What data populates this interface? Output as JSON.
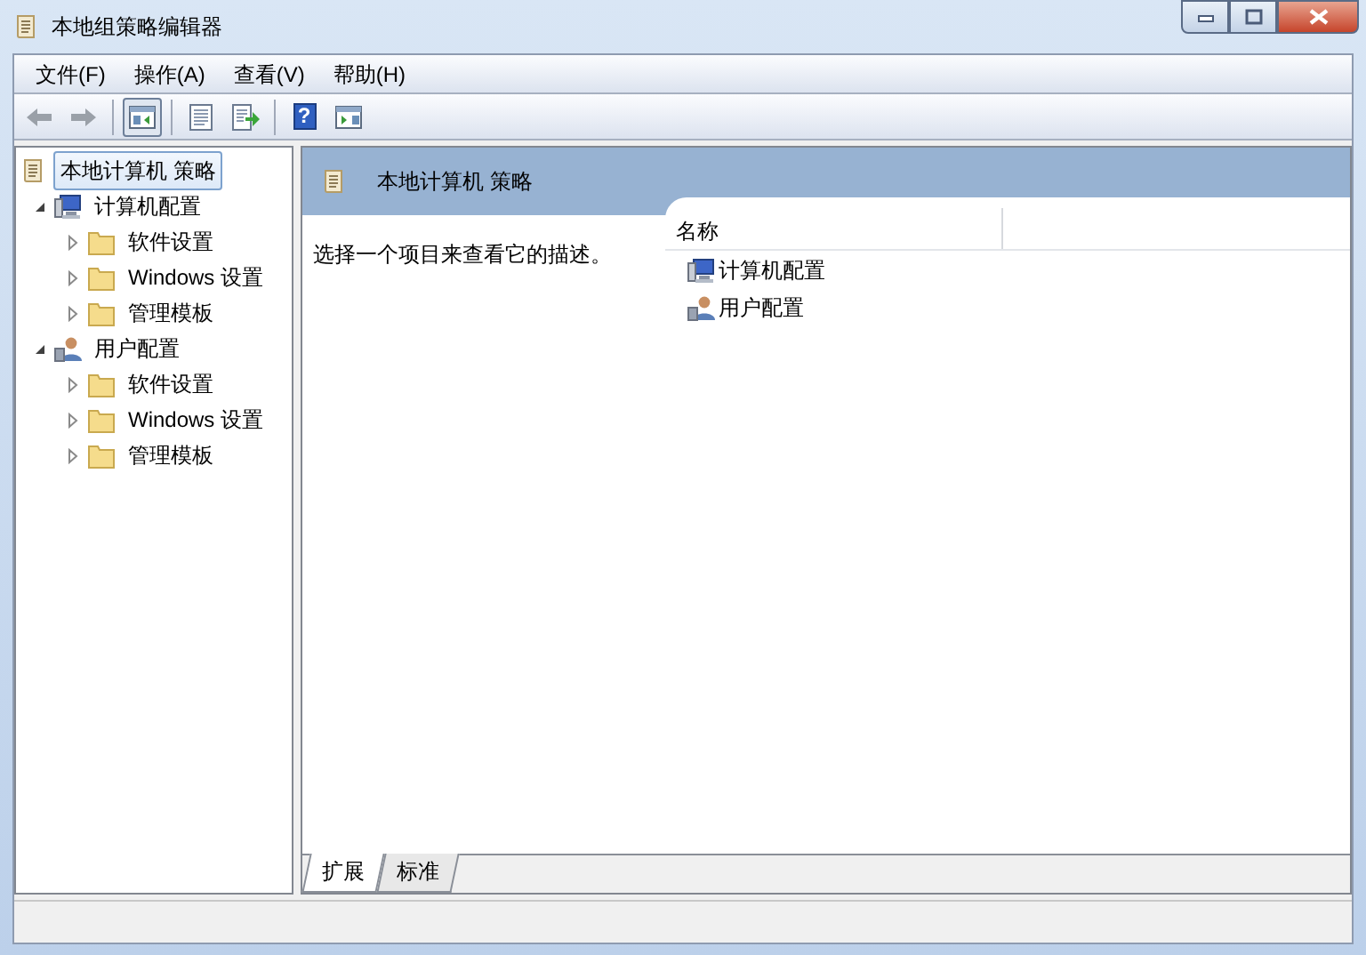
{
  "window": {
    "title": "本地组策略编辑器"
  },
  "menu": [
    "文件(F)",
    "操作(A)",
    "查看(V)",
    "帮助(H)"
  ],
  "toolbar": [
    {
      "kind": "back",
      "disabled": true,
      "pressed": false
    },
    {
      "kind": "forward",
      "disabled": true,
      "pressed": false
    },
    {
      "kind": "tree",
      "disabled": false,
      "pressed": true
    },
    {
      "kind": "properties",
      "disabled": false,
      "pressed": false
    },
    {
      "kind": "export",
      "disabled": false,
      "pressed": false
    },
    {
      "kind": "help",
      "label": "?",
      "disabled": false,
      "pressed": false
    },
    {
      "kind": "pane",
      "disabled": false,
      "pressed": false
    }
  ],
  "tree": [
    {
      "label": "本地计算机 策略",
      "kind": "policy",
      "selected": true,
      "children": [
        {
          "label": "计算机配置",
          "kind": "computer",
          "selected": false,
          "expanded": true,
          "children": [
            {
              "label": "软件设置",
              "kind": "folder",
              "selected": false,
              "expanded": false
            },
            {
              "label": "Windows 设置",
              "kind": "folder",
              "selected": false,
              "expanded": false
            },
            {
              "label": "管理模板",
              "kind": "folder",
              "selected": false,
              "expanded": false
            }
          ]
        },
        {
          "label": "用户配置",
          "kind": "user",
          "selected": false,
          "expanded": true,
          "children": [
            {
              "label": "软件设置",
              "kind": "folder",
              "selected": false,
              "expanded": false
            },
            {
              "label": "Windows 设置",
              "kind": "folder",
              "selected": false,
              "expanded": false
            },
            {
              "label": "管理模板",
              "kind": "folder",
              "selected": false,
              "expanded": false
            }
          ]
        }
      ]
    }
  ],
  "detail": {
    "title": "本地计算机 策略",
    "description": "选择一个项目来查看它的描述。",
    "columns": [
      "名称"
    ],
    "items": [
      {
        "label": "计算机配置",
        "kind": "computer"
      },
      {
        "label": "用户配置",
        "kind": "user"
      }
    ]
  },
  "bottom_tabs": [
    {
      "label": "扩展",
      "selected": true
    },
    {
      "label": "标准",
      "selected": false
    }
  ]
}
